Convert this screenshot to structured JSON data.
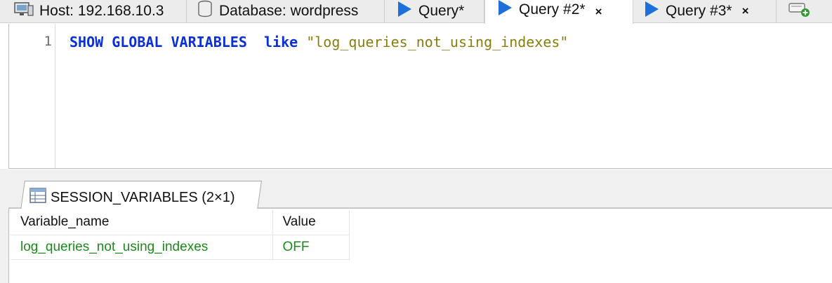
{
  "tabs": [
    {
      "label": "Host: 192.168.10.3",
      "icon": "host-icon",
      "active": false,
      "closable": false
    },
    {
      "label": "Database: wordpress",
      "icon": "database-icon",
      "active": false,
      "closable": false
    },
    {
      "label": "Query*",
      "icon": "query-icon",
      "active": false,
      "closable": false
    },
    {
      "label": "Query #2*",
      "icon": "query-icon",
      "active": true,
      "closable": true,
      "close_label": "×"
    },
    {
      "label": "Query #3*",
      "icon": "query-icon",
      "active": false,
      "closable": true,
      "close_label": "×"
    },
    {
      "label": "",
      "icon": "new-query-icon",
      "active": false,
      "closable": false
    }
  ],
  "editor": {
    "line_number": "1",
    "tokens": {
      "keyword1": "SHOW",
      "keyword2": "GLOBAL",
      "keyword3": "VARIABLES",
      "keyword4": "like",
      "string": "\"log_queries_not_using_indexes\""
    }
  },
  "result_tab": {
    "label": "SESSION_VARIABLES (2×1)",
    "icon": "table-icon"
  },
  "grid": {
    "columns": [
      "Variable_name",
      "Value"
    ],
    "rows": [
      [
        "log_queries_not_using_indexes",
        "OFF"
      ]
    ]
  },
  "colors": {
    "keyword": "#0a2fd8",
    "string": "#8a7d0f",
    "result_value": "#1b8a1b",
    "query_icon": "#1e6fd9"
  }
}
